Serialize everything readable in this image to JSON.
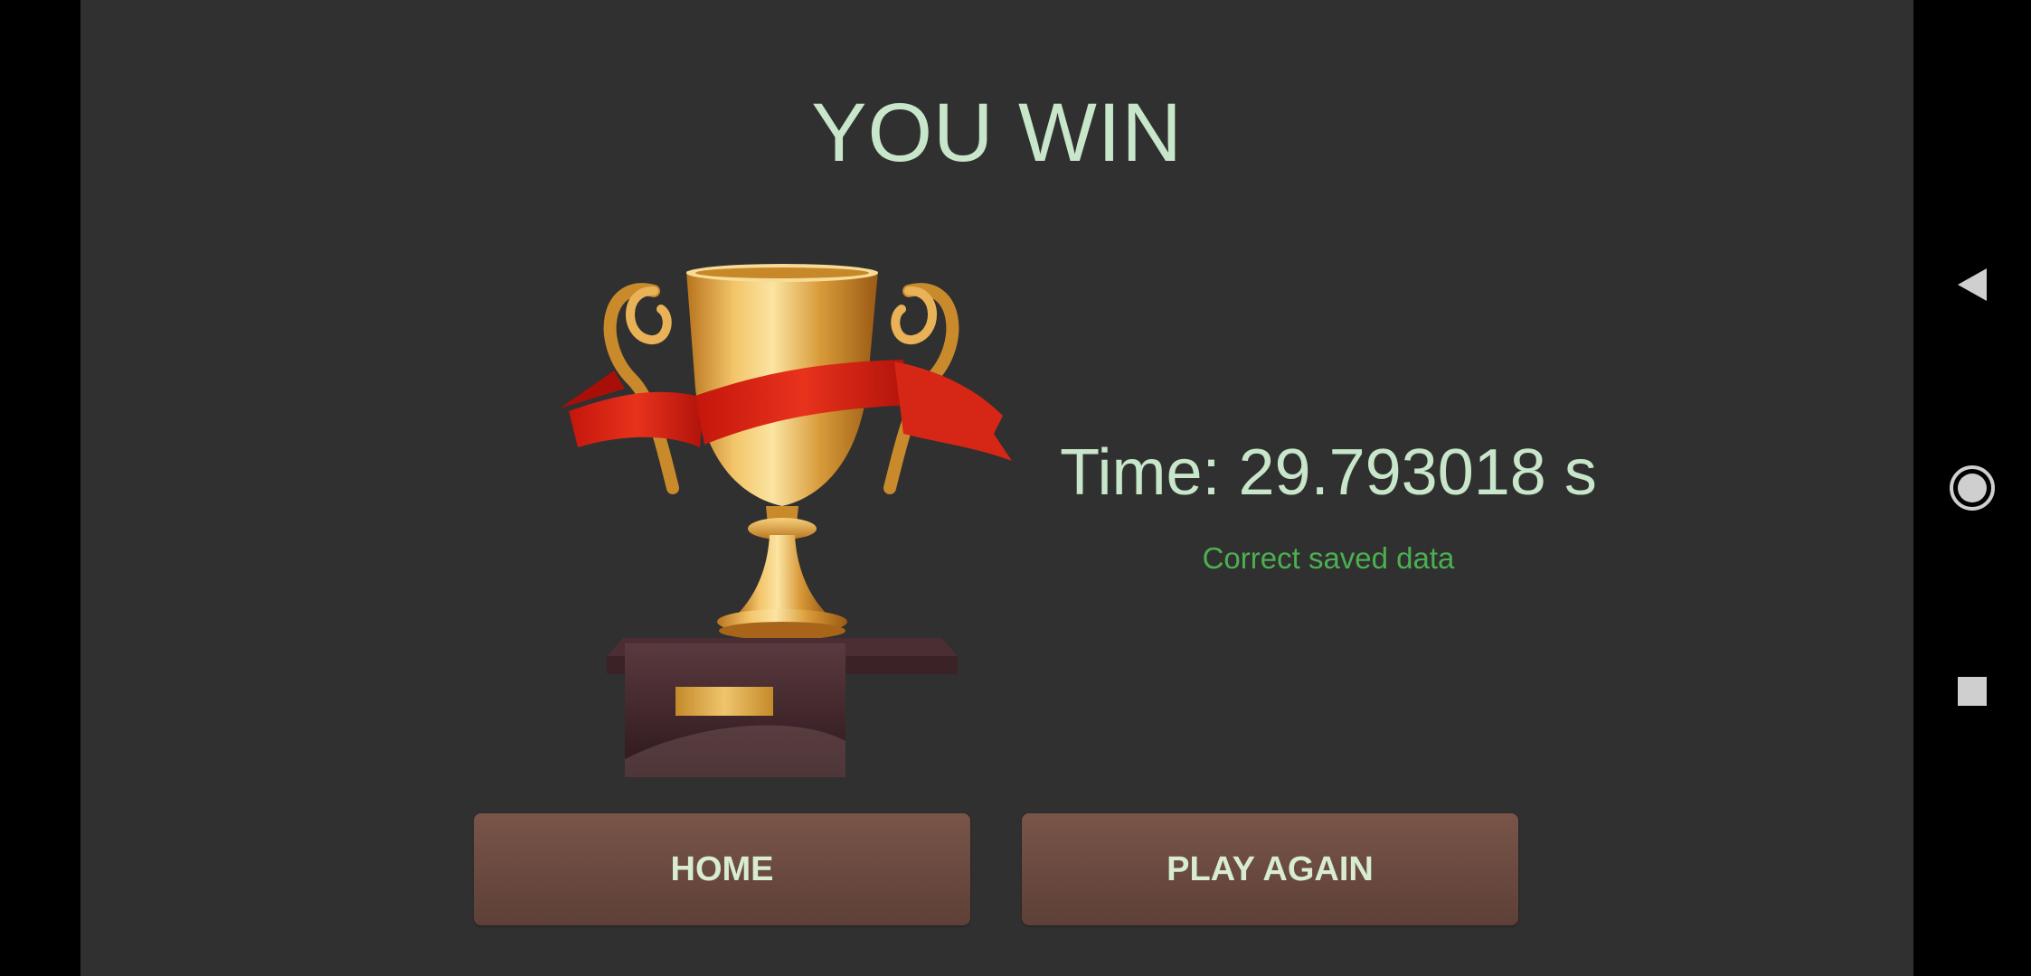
{
  "result": {
    "title": "YOU WIN",
    "time_text": "Time: 29.793018 s",
    "status_text": "Correct saved data"
  },
  "buttons": {
    "home_label": "HOME",
    "play_again_label": "PLAY AGAIN"
  },
  "trophy": {
    "icon": "trophy-icon"
  },
  "system_nav": {
    "back_icon": "back-triangle-icon",
    "home_icon": "home-circle-icon",
    "recents_icon": "recents-square-icon"
  },
  "colors": {
    "background": "#303030",
    "title_text": "#c8e6c9",
    "status_text": "#4caf50",
    "button_bg": "#6d4c41",
    "button_text": "#d7ecd0"
  }
}
